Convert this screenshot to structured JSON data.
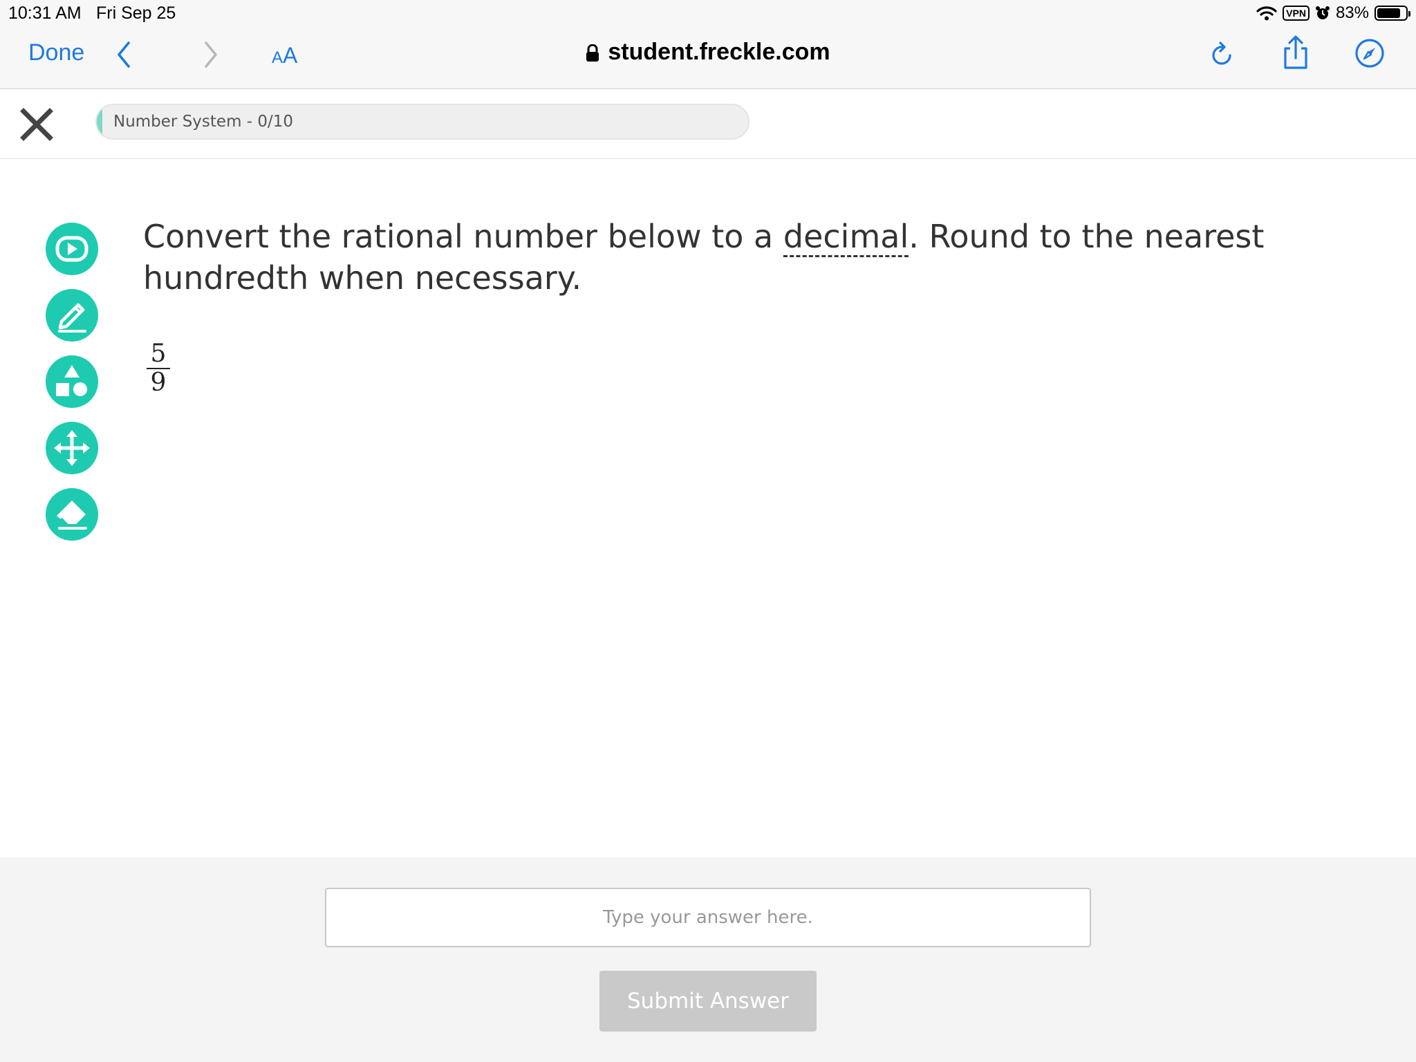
{
  "status_bar": {
    "time": "10:31 AM",
    "date": "Fri Sep 25",
    "vpn_label": "VPN",
    "battery_percent": "83%",
    "battery_level": 0.83
  },
  "browser": {
    "done_label": "Done",
    "aa_small": "A",
    "aa_large": "A",
    "url": "student.freckle.com",
    "accent_color": "#1e7ae0",
    "icons": [
      "back-chevron-icon",
      "forward-chevron-icon",
      "reload-icon",
      "share-icon",
      "compass-icon",
      "lock-icon"
    ]
  },
  "header": {
    "progress_label": "Number System - 0/10",
    "progress_fraction": 0,
    "close_icon": "close-icon"
  },
  "tools": [
    {
      "name": "video-tool",
      "icon": "play-icon"
    },
    {
      "name": "pencil-tool",
      "icon": "pencil-icon"
    },
    {
      "name": "shapes-tool",
      "icon": "shapes-icon"
    },
    {
      "name": "move-tool",
      "icon": "move-arrows-icon"
    },
    {
      "name": "eraser-tool",
      "icon": "eraser-icon"
    }
  ],
  "tool_color": "#1ecbb0",
  "question": {
    "text_before": "Convert the rational number below to a ",
    "term": "decimal",
    "text_after": ". Round to the nearest hundredth when necessary.",
    "fraction": {
      "numerator": "5",
      "denominator": "9"
    }
  },
  "answer": {
    "placeholder": "Type your answer here.",
    "value": "",
    "submit_label": "Submit Answer"
  }
}
